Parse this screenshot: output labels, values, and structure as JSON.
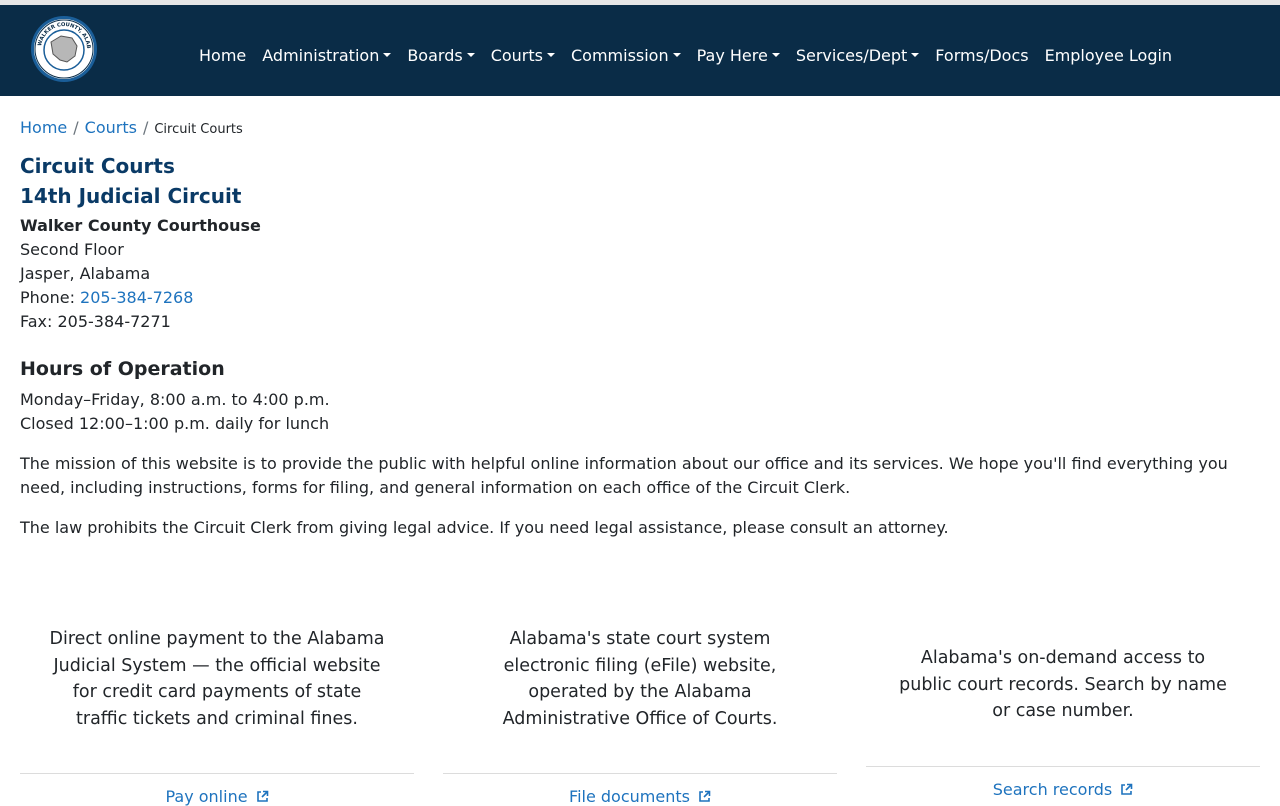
{
  "logo": {
    "text": "WALKER COUNTY, ALABAMA"
  },
  "nav": [
    {
      "label": "Home",
      "dropdown": false
    },
    {
      "label": "Administration",
      "dropdown": true
    },
    {
      "label": "Boards",
      "dropdown": true
    },
    {
      "label": "Courts",
      "dropdown": true
    },
    {
      "label": "Commission",
      "dropdown": true
    },
    {
      "label": "Pay Here",
      "dropdown": true
    },
    {
      "label": "Services/Dept",
      "dropdown": true
    },
    {
      "label": "Forms/Docs",
      "dropdown": false
    },
    {
      "label": "Employee Login",
      "dropdown": false
    }
  ],
  "breadcrumb": {
    "home": "Home",
    "sep": "/",
    "courts": "Courts",
    "current": "Circuit Courts"
  },
  "page": {
    "title": "Circuit Courts",
    "subtitle": "14th Judicial Circuit",
    "courthouse": "Walker County Courthouse",
    "floor": "Second Floor",
    "city": "Jasper, Alabama",
    "phone_label": "Phone: ",
    "phone": "205-384-7268",
    "fax": "Fax: 205-384-7271",
    "hours_heading": "Hours of Operation",
    "hours_1": "Monday–Friday, 8:00 a.m. to 4:00 p.m.",
    "hours_2": "Closed 12:00–1:00 p.m. daily for lunch",
    "mission_1": "The mission of this website is to provide the public with helpful online information about our office and its services. We hope you'll find everything you",
    "mission_2": "need, including instructions, forms for filing, and general information on each office of the Circuit Clerk.",
    "legal": "The law prohibits the Circuit Clerk from giving legal advice. If you need legal assistance, please consult an attorney."
  },
  "cards": [
    {
      "lines": [
        "Direct online payment to the Alabama",
        "Judicial System — the official website",
        "for credit card payments of state",
        "traffic tickets and criminal fines."
      ],
      "link": "Pay online"
    },
    {
      "lines": [
        "Alabama's state court system",
        "electronic filing (eFile) website,",
        "operated by the Alabama",
        "Administrative Office of Courts."
      ],
      "link": "File documents"
    },
    {
      "lines": [
        "Alabama's on-demand access to",
        "public court records. Search by name",
        "or case number."
      ],
      "link": "Search records"
    }
  ],
  "colors": {
    "navbar": "#0a2c47",
    "link": "#1e73be",
    "heading": "#0a3a66"
  },
  "icons": {
    "external": "external-link-icon",
    "logo": "county-seal-logo"
  }
}
